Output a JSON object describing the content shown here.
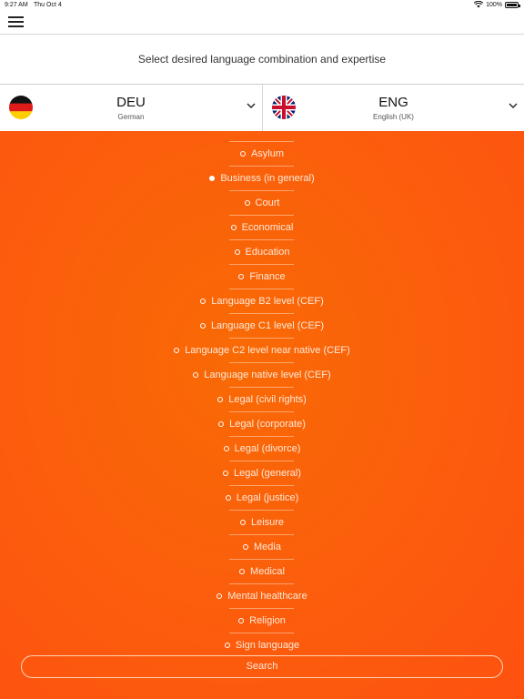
{
  "status_bar": {
    "time": "9:27 AM",
    "date": "Thu Oct 4",
    "battery": "100%"
  },
  "instruction": "Select desired language combination and expertise",
  "source_language": {
    "code": "DEU",
    "name": "German",
    "flag": "germany-flag"
  },
  "target_language": {
    "code": "ENG",
    "name": "English (UK)",
    "flag": "uk-flag"
  },
  "expertise": {
    "selected": "Business (in general)",
    "items": [
      {
        "label": "Asylum",
        "checked": false
      },
      {
        "label": "Business (in general)",
        "checked": true
      },
      {
        "label": "Court",
        "checked": false
      },
      {
        "label": "Economical",
        "checked": false
      },
      {
        "label": "Education",
        "checked": false
      },
      {
        "label": "Finance",
        "checked": false
      },
      {
        "label": "Language B2 level (CEF)",
        "checked": false
      },
      {
        "label": "Language C1 level (CEF)",
        "checked": false
      },
      {
        "label": "Language C2 level near native (CEF)",
        "checked": false
      },
      {
        "label": "Language native level  (CEF)",
        "checked": false
      },
      {
        "label": "Legal (civil rights)",
        "checked": false
      },
      {
        "label": "Legal (corporate)",
        "checked": false
      },
      {
        "label": "Legal (divorce)",
        "checked": false
      },
      {
        "label": "Legal (general)",
        "checked": false
      },
      {
        "label": "Legal (justice)",
        "checked": false
      },
      {
        "label": "Leisure",
        "checked": false
      },
      {
        "label": "Media",
        "checked": false
      },
      {
        "label": "Medical",
        "checked": false
      },
      {
        "label": "Mental healthcare",
        "checked": false
      },
      {
        "label": "Religion",
        "checked": false
      },
      {
        "label": "Sign language",
        "checked": false
      }
    ]
  },
  "search_button": {
    "label": "Search"
  },
  "colors": {
    "accent": "#fb5e0c",
    "text_on_accent": "#ffe9d8"
  }
}
